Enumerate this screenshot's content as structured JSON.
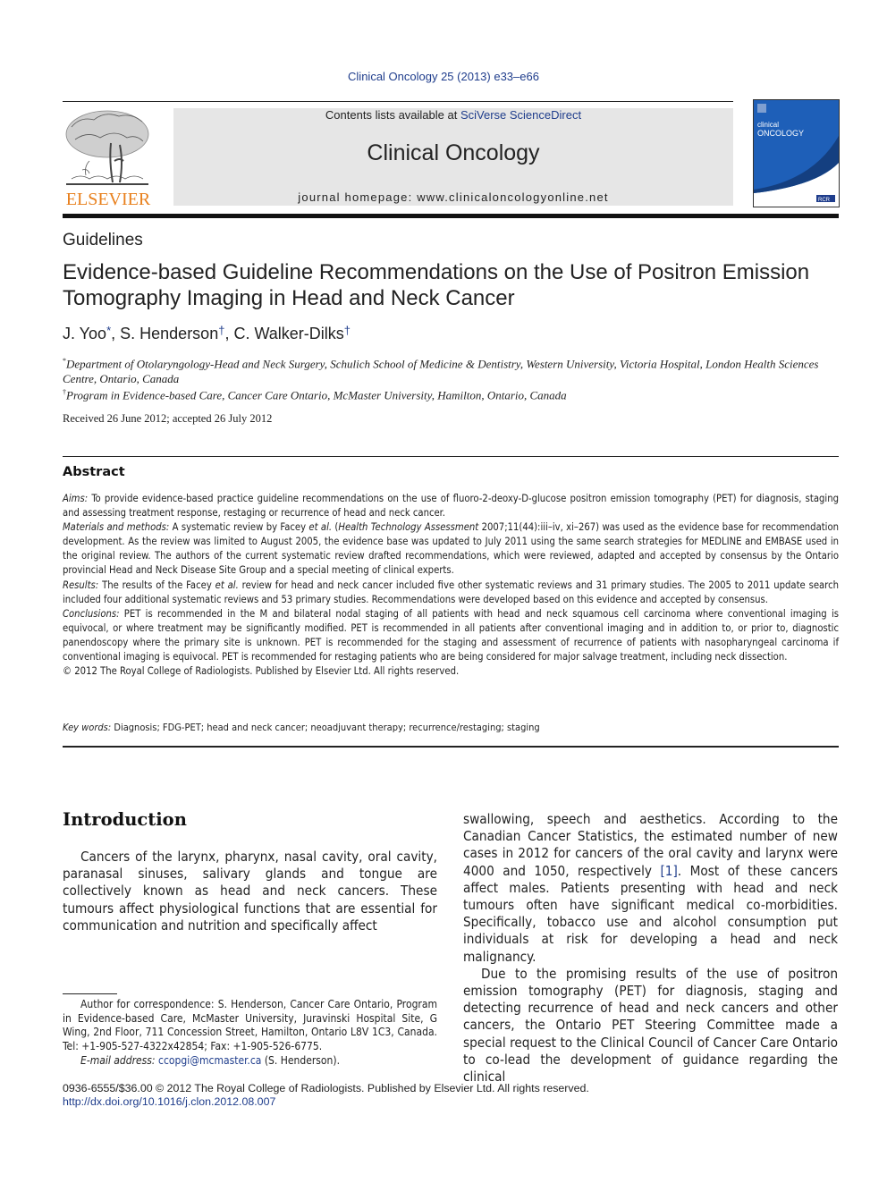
{
  "header": {
    "journal_reference": "Clinical Oncology 25 (2013) e33–e66",
    "contents_prefix": "Contents lists available at ",
    "contents_link": "SciVerse ScienceDirect",
    "journal_name": "Clinical Oncology",
    "homepage_prefix": "journal homepage: ",
    "homepage_url": "www.clinicaloncologyonline.net",
    "publisher_logo_text": "ELSEVIER",
    "publisher_color": "#e8801d",
    "cover": {
      "title_line1": "clinical",
      "title_line2": "ONCOLOGY",
      "badge": "RCR",
      "color": "#1e5fb8"
    }
  },
  "article": {
    "section_type": "Guidelines",
    "title": "Evidence-based Guideline Recommendations on the Use of Positron Emission Tomography Imaging in Head and Neck Cancer",
    "authors": [
      {
        "name": "J. Yoo",
        "mark": "*"
      },
      {
        "name": "S. Henderson",
        "mark": "†"
      },
      {
        "name": "C. Walker-Dilks",
        "mark": "†"
      }
    ],
    "author_separator": ", ",
    "affiliations": [
      {
        "mark": "*",
        "text": "Department of Otolaryngology-Head and Neck Surgery, Schulich School of Medicine & Dentistry, Western University, Victoria Hospital, London Health Sciences Centre, Ontario, Canada"
      },
      {
        "mark": "†",
        "text": "Program in Evidence-based Care, Cancer Care Ontario, McMaster University, Hamilton, Ontario, Canada"
      }
    ],
    "received": "Received 26 June 2012; accepted 26 July 2012"
  },
  "abstract": {
    "heading": "Abstract",
    "aims_label": "Aims:",
    "aims_text": " To provide evidence-based practice guideline recommendations on the use of fluoro-2-deoxy-D-glucose positron emission tomography (PET) for diagnosis, staging and assessing treatment response, restaging or recurrence of head and neck cancer.",
    "methods_label": "Materials and methods:",
    "methods_text_1": " A systematic review by Facey ",
    "methods_etal": "et al.",
    "methods_text_2": " (",
    "methods_source": "Health Technology Assessment",
    "methods_text_3": " 2007;11(44):iii–iv, xi–267) was used as the evidence base for recommendation development. As the review was limited to August 2005, the evidence base was updated to July 2011 using the same search strategies for MEDLINE and EMBASE used in the original review. The authors of the current systematic review drafted recommendations, which were reviewed, adapted and accepted by consensus by the Ontario provincial Head and Neck Disease Site Group and a special meeting of clinical experts.",
    "results_label": "Results:",
    "results_text_1": " The results of the Facey ",
    "results_etal": "et al.",
    "results_text_2": " review for head and neck cancer included five other systematic reviews and 31 primary studies. The 2005 to 2011 update search included four additional systematic reviews and 53 primary studies. Recommendations were developed based on this evidence and accepted by consensus.",
    "conclusions_label": "Conclusions:",
    "conclusions_text": " PET is recommended in the M and bilateral nodal staging of all patients with head and neck squamous cell carcinoma where conventional imaging is equivocal, or where treatment may be significantly modified. PET is recommended in all patients after conventional imaging and in addition to, or prior to, diagnostic panendoscopy where the primary site is unknown. PET is recommended for the staging and assessment of recurrence of patients with nasopharyngeal carcinoma if conventional imaging is equivocal. PET is recommended for restaging patients who are being considered for major salvage treatment, including neck dissection.",
    "copyright": "© 2012 The Royal College of Radiologists. Published by Elsevier Ltd. All rights reserved.",
    "keywords_label": "Key words:",
    "keywords_text": " Diagnosis; FDG-PET; head and neck cancer; neoadjuvant therapy; recurrence/restaging; staging"
  },
  "introduction": {
    "heading": "Introduction",
    "para1": "Cancers of the larynx, pharynx, nasal cavity, oral cavity, paranasal sinuses, salivary glands and tongue are collectively known as head and neck cancers. These tumours affect physiological functions that are essential for communication and nutrition and specifically affect",
    "para1_cont_1": "swallowing, speech and aesthetics. According to the Canadian Cancer Statistics, the estimated number of new cases in 2012 for cancers of the oral cavity and larynx were 4000 and 1050, respectively ",
    "para1_ref": "[1]",
    "para1_cont_2": ". Most of these cancers affect males. Patients presenting with head and neck tumours often have significant medical co-morbidities. Specifically, tobacco use and alcohol consumption put individuals at risk for developing a head and neck malignancy.",
    "para2": "Due to the promising results of the use of positron emission tomography (PET) for diagnosis, staging and detecting recurrence of head and neck cancers and other cancers, the Ontario PET Steering Committee made a special request to the Clinical Council of Cancer Care Ontario to co-lead the development of guidance regarding the clinical"
  },
  "footnote": {
    "correspondence": "Author for correspondence: S. Henderson, Cancer Care Ontario, Program in Evidence-based Care, McMaster University, Juravinski Hospital Site, G Wing, 2nd Floor, 711 Concession Street, Hamilton, Ontario L8V 1C3, Canada. Tel: +1-905-527-4322x42854; Fax: +1-905-526-6775.",
    "email_label": "E-mail address:",
    "email": "ccopgi@mcmaster.ca",
    "email_suffix": " (S. Henderson)."
  },
  "footer": {
    "issn_line": "0936-6555/$36.00 © 2012 The Royal College of Radiologists. Published by Elsevier Ltd. All rights reserved.",
    "doi": "http://dx.doi.org/10.1016/j.clon.2012.08.007"
  }
}
